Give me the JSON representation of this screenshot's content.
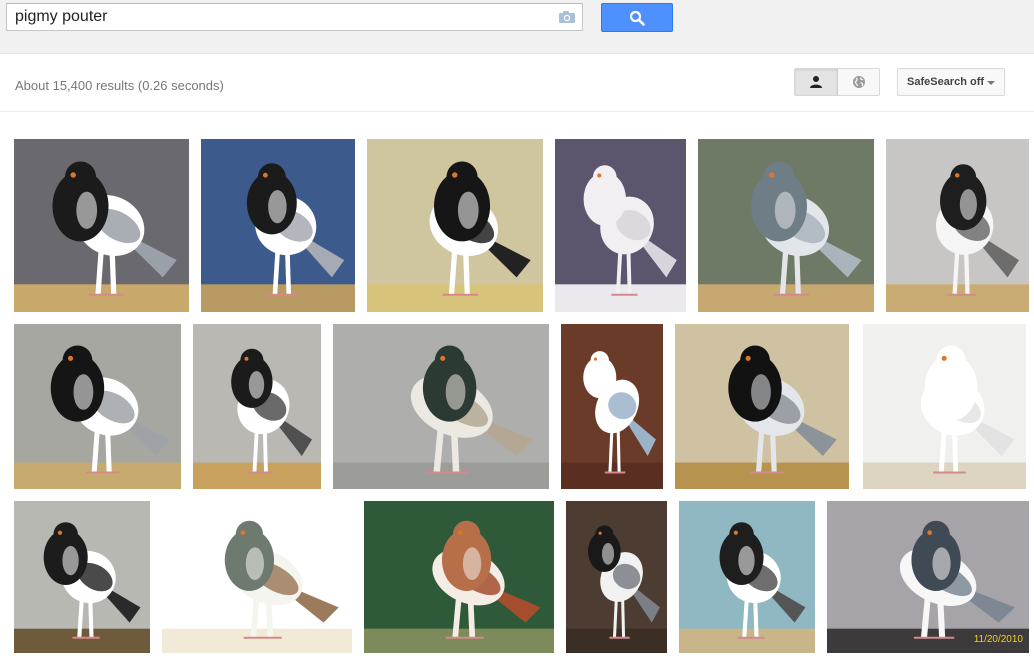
{
  "search": {
    "query": "pigmy pouter"
  },
  "results": {
    "stats": "About 15,400 results (0.26 seconds)",
    "safesearch_label": "SafeSearch off"
  },
  "icons": {
    "camera": "camera-icon",
    "search": "magnifier-icon",
    "personal": "person-icon",
    "world": "globe-icon",
    "dropdown": "caret-down-icon"
  },
  "colors": {
    "search_button": "#4d90fe",
    "topbar_bg": "#f1f1f1",
    "stats_text": "#777777"
  },
  "images": [
    {
      "bg": "#6b6970",
      "floor": "#c9a86b",
      "body": "#ffffff",
      "head": "#1b1b1b",
      "accent": "#9aa0a8"
    },
    {
      "bg": "#3d5a8c",
      "floor": "#b89a62",
      "body": "#ffffff",
      "head": "#1b1b1b",
      "accent": "#a6aab2"
    },
    {
      "bg": "#cfc6a0",
      "floor": "#d7c37a",
      "body": "#ffffff",
      "head": "#161616",
      "accent": "#222222"
    },
    {
      "bg": "#5b566e",
      "floor": "#ece9ee",
      "body": "#f2eff2",
      "head": "#f2eff2",
      "accent": "#d9d3db"
    },
    {
      "bg": "#6e7a66",
      "floor": "#c7a871",
      "body": "#e2e6ea",
      "head": "#6f7d86",
      "accent": "#aab4bd"
    },
    {
      "bg": "#c8c6c4",
      "floor": "#c9ac74",
      "body": "#f5f5f5",
      "head": "#1e1e1e",
      "accent": "#6d6d6d"
    },
    {
      "bg": "#a7a7a2",
      "floor": "#c7aa70",
      "body": "#ffffff",
      "head": "#151515",
      "accent": "#9fa3a8"
    },
    {
      "bg": "#b9b8b3",
      "floor": "#c8a15f",
      "body": "#ffffff",
      "head": "#1b1b1b",
      "accent": "#505050"
    },
    {
      "bg": "#aeafac",
      "floor": "#9c9c98",
      "body": "#ece8e2",
      "head": "#2b3a32",
      "accent": "#b4a894"
    },
    {
      "bg": "#6b3b2a",
      "floor": "#5a2e20",
      "body": "#ffffff",
      "head": "#ffffff",
      "accent": "#9cb2c8"
    },
    {
      "bg": "#cfc2a2",
      "floor": "#b8924f",
      "body": "#e3e6ea",
      "head": "#121212",
      "accent": "#8d939a"
    },
    {
      "bg": "#f0f0ee",
      "floor": "#ddd4c2",
      "body": "#ffffff",
      "head": "#ffffff",
      "accent": "#e3e3e3"
    },
    {
      "bg": "#b8b8b2",
      "floor": "#6e5b3b",
      "body": "#ffffff",
      "head": "#1c1c1c",
      "accent": "#2a2a2a"
    },
    {
      "bg": "#ffffff",
      "floor": "#f1ead7",
      "body": "#f5f5f0",
      "head": "#6e7a70",
      "accent": "#9c7a5c"
    },
    {
      "bg": "#2f5a39",
      "floor": "#7d8b5b",
      "body": "#f3ede6",
      "head": "#b76f4a",
      "accent": "#a44e2e"
    },
    {
      "bg": "#4c3c31",
      "floor": "#3a2e25",
      "body": "#f2f2f2",
      "head": "#191919",
      "accent": "#7a7f86"
    },
    {
      "bg": "#8fb8c3",
      "floor": "#c9b58a",
      "body": "#ffffff",
      "head": "#1e1e1e",
      "accent": "#555555"
    },
    {
      "bg": "#a6a4a8",
      "floor": "#3c3a3b",
      "body": "#f7f7f7",
      "head": "#404a55",
      "accent": "#7d8894"
    }
  ],
  "image_date_stamp": "11/20/2010"
}
